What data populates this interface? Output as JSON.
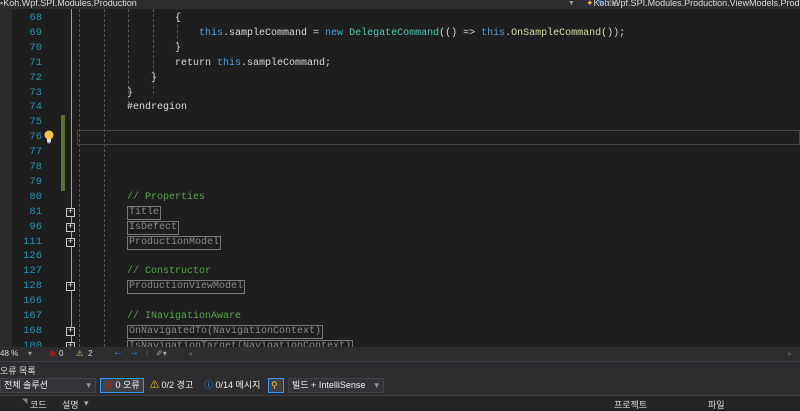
{
  "nav": {
    "project": "Koh.Wpf.SPI.Modules.Production",
    "class": "Koh.Wpf.SPI.Modules.Production.ViewModels.ProductionViewModel",
    "member": "title"
  },
  "colors": {
    "keyword": "#569cd6",
    "type": "#4ec9b0",
    "method": "#dcdcaa",
    "text": "#dcdcdc",
    "comment": "#57a64a",
    "linenum": "#2b91af"
  },
  "code_lines": [
    {
      "num": "68",
      "col": 175,
      "segs": [
        {
          "t": "{",
          "c": "text"
        }
      ]
    },
    {
      "num": "69",
      "col": 199,
      "segs": [
        {
          "t": "this",
          "c": "keyword"
        },
        {
          "t": ".sampleCommand = ",
          "c": "text"
        },
        {
          "t": "new ",
          "c": "keyword"
        },
        {
          "t": "DelegateCommand",
          "c": "type"
        },
        {
          "t": "(() => ",
          "c": "text"
        },
        {
          "t": "this",
          "c": "keyword"
        },
        {
          "t": ".",
          "c": "text"
        },
        {
          "t": "OnSampleCommand",
          "c": "method"
        },
        {
          "t": "());",
          "c": "text"
        }
      ]
    },
    {
      "num": "70",
      "col": 175,
      "segs": [
        {
          "t": "}",
          "c": "text"
        }
      ]
    },
    {
      "num": "71",
      "col": 175,
      "segs": [
        {
          "t": "return ",
          "c": "text"
        },
        {
          "t": "this",
          "c": "keyword"
        },
        {
          "t": ".sampleCommand;",
          "c": "text"
        }
      ]
    },
    {
      "num": "72",
      "col": 151,
      "segs": [
        {
          "t": "}",
          "c": "text"
        }
      ]
    },
    {
      "num": "73",
      "col": 127,
      "segs": [
        {
          "t": "}",
          "c": "text"
        }
      ]
    },
    {
      "num": "74",
      "col": 127,
      "segs": [
        {
          "t": "#endregion",
          "c": "text"
        }
      ]
    },
    {
      "num": "75",
      "col": 127,
      "segs": []
    },
    {
      "num": "76",
      "col": 127,
      "segs": []
    },
    {
      "num": "77",
      "col": 127,
      "segs": []
    },
    {
      "num": "78",
      "col": 127,
      "segs": []
    },
    {
      "num": "79",
      "col": 127,
      "segs": []
    },
    {
      "num": "80",
      "col": 127,
      "segs": [
        {
          "t": "// Properties",
          "c": "comment"
        }
      ]
    },
    {
      "num": "81",
      "col": 127,
      "fold": true,
      "segs": [
        {
          "t": "Title",
          "c": "box"
        }
      ]
    },
    {
      "num": "96",
      "col": 127,
      "fold": true,
      "segs": [
        {
          "t": "IsDefect",
          "c": "box"
        }
      ]
    },
    {
      "num": "111",
      "col": 127,
      "fold": true,
      "segs": [
        {
          "t": "ProductionModel",
          "c": "box"
        }
      ]
    },
    {
      "num": "126",
      "col": 127,
      "segs": []
    },
    {
      "num": "127",
      "col": 127,
      "segs": [
        {
          "t": "// Constructor",
          "c": "comment"
        }
      ]
    },
    {
      "num": "128",
      "col": 127,
      "fold": true,
      "segs": [
        {
          "t": "ProductionViewModel",
          "c": "box"
        }
      ]
    },
    {
      "num": "166",
      "col": 127,
      "segs": []
    },
    {
      "num": "167",
      "col": 127,
      "segs": [
        {
          "t": "// INavigationAware",
          "c": "comment"
        }
      ]
    },
    {
      "num": "168",
      "col": 127,
      "fold": true,
      "segs": [
        {
          "t": "OnNavigatedTo(NavigationContext)",
          "c": "box"
        }
      ]
    },
    {
      "num": "180",
      "col": 127,
      "fold": true,
      "segs": [
        {
          "t": "IsNavigationTarget(NavigationContext)",
          "c": "box"
        }
      ]
    }
  ],
  "status": {
    "zoom": "48 %",
    "errors": "0",
    "warnings": "2"
  },
  "error_list": {
    "title": "오류 목록",
    "scope": "전체 솔루션",
    "errors_btn": "0 오류",
    "warnings_btn": "0/2 경고",
    "messages_btn": "0/14 메시지",
    "source": "빌드 + IntelliSense",
    "columns": {
      "code": "코드",
      "description": "설명",
      "project": "프로젝트",
      "file": "파일"
    }
  }
}
